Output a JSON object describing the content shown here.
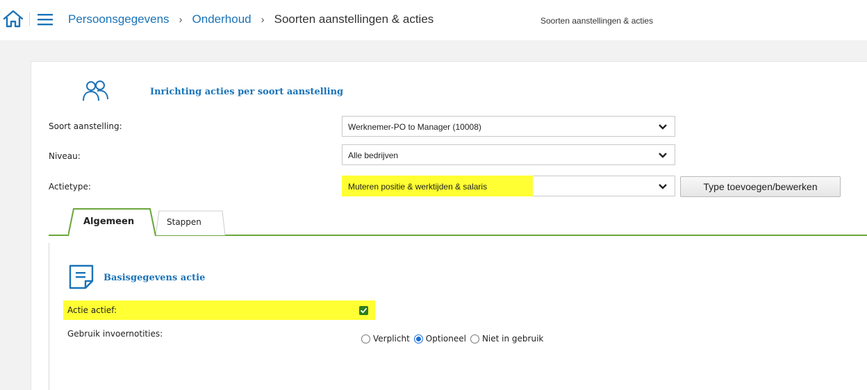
{
  "icons": {
    "home": "home-icon",
    "menu": "hamburger-menu-icon",
    "users": "users-icon",
    "chevron": "chevron-down-icon",
    "document": "document-icon",
    "checkbox": "checkmark-icon"
  },
  "colors": {
    "link": "#1a73b8",
    "tab_accent": "#6aa63a",
    "highlight": "#ffff33",
    "checkbox": "#2e7d1e",
    "radio": "#1a6fd8"
  },
  "breadcrumb": {
    "items": [
      "Persoonsgegevens",
      "Onderhoud",
      "Soorten aanstellingen & acties"
    ],
    "separator": "›",
    "subtitle": "Soorten aanstellingen & acties"
  },
  "section": {
    "title": "Inrichting acties per soort aanstelling"
  },
  "form": {
    "soort_label": "Soort aanstelling:",
    "soort_value": "Werknemer-PO to Manager (10008)",
    "niveau_label": "Niveau:",
    "niveau_value": "Alle bedrijven",
    "actietype_label": "Actietype:",
    "actietype_value": "Muteren positie & werktijden & salaris",
    "type_button": "Type toevoegen/bewerken"
  },
  "tabs": [
    {
      "label": "Algemeen",
      "active": true
    },
    {
      "label": "Stappen",
      "active": false
    }
  ],
  "basis": {
    "title": "Basisgegevens actie",
    "actief_label": "Actie actief:",
    "actief_checked": true,
    "invoer_label": "Gebruik invoernotities:",
    "options": [
      "Verplicht",
      "Optioneel",
      "Niet in gebruik"
    ],
    "selected": "Optioneel"
  }
}
